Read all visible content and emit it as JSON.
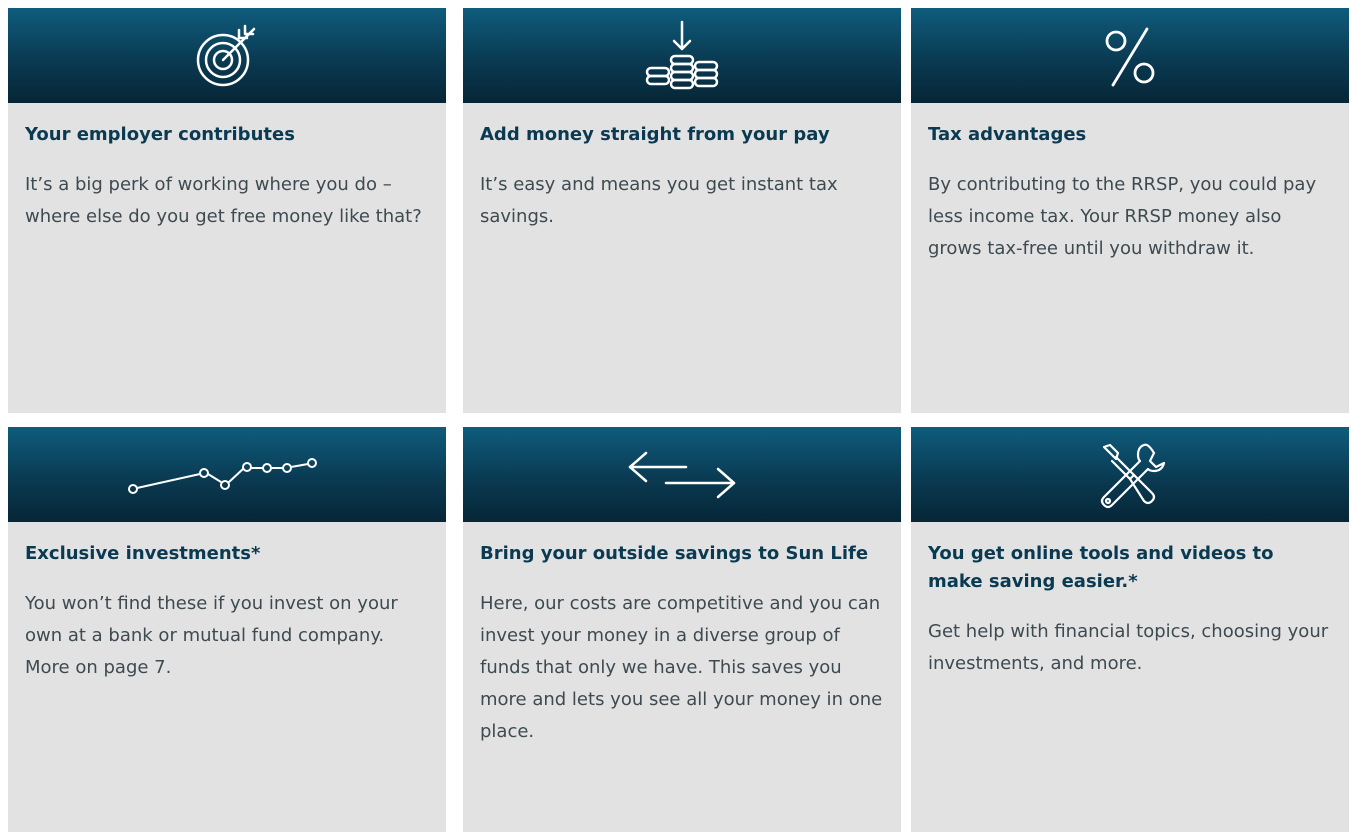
{
  "cards": [
    {
      "icon": "target-icon",
      "title": "Your employer contributes",
      "text": "It’s a big perk of working where you do – where else do you get free money like that?"
    },
    {
      "icon": "coins-arrow-icon",
      "title": "Add money straight from your pay",
      "text": "It’s easy and means you get instant tax savings."
    },
    {
      "icon": "percent-icon",
      "title": "Tax advantages",
      "text": "By contributing to the RRSP, you could pay less income tax. Your RRSP money also grows tax-free until you withdraw it."
    },
    {
      "icon": "line-graph-icon",
      "title": "Exclusive investments*",
      "text": "You won’t find these if you invest on your own at a bank or mutual fund company. More on page 7."
    },
    {
      "icon": "transfer-arrows-icon",
      "title": "Bring your outside savings to Sun Life",
      "text": "Here, our costs are competitive and you can invest your money in a diverse group of funds that only we have. This saves you more and lets you see all your money in one place."
    },
    {
      "icon": "tools-icon",
      "title": "You get online tools and videos to make saving easier.*",
      "text": "Get help with financial topics, choosing your investments, and more."
    }
  ],
  "colors": {
    "band_top": "#0f5c7d",
    "band_bottom": "#062636",
    "card_bg": "#e3e2e2",
    "title": "#0a3a52",
    "text": "#3d4a50",
    "icon": "#ffffff"
  }
}
